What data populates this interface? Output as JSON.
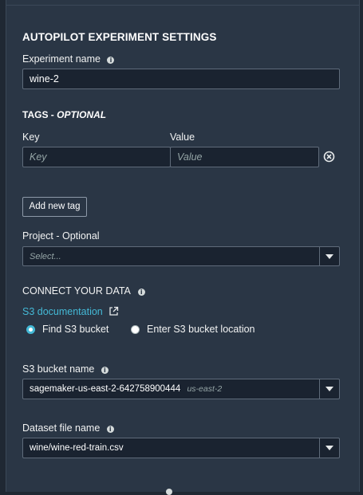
{
  "settings": {
    "title": "AUTOPILOT EXPERIMENT SETTINGS",
    "experiment_name_label": "Experiment name",
    "experiment_name_value": "wine-2"
  },
  "tags": {
    "title_prefix": "TAGS - ",
    "title_optional": "OPTIONAL",
    "key_label": "Key",
    "value_label": "Value",
    "key_placeholder": "Key",
    "value_placeholder": "Value",
    "add_button": "Add new tag"
  },
  "project": {
    "label": "Project - Optional",
    "placeholder": "Select..."
  },
  "connect": {
    "title": "CONNECT YOUR DATA",
    "doc_link": "S3 documentation",
    "option_find": "Find S3 bucket",
    "option_enter": "Enter S3 bucket location",
    "selected_option": "Find S3 bucket"
  },
  "bucket": {
    "label": "S3 bucket name",
    "value": "sagemaker-us-east-2-642758900444",
    "region": "us-east-2"
  },
  "dataset": {
    "label": "Dataset file name",
    "value": "wine/wine-red-train.csv"
  },
  "icons": [
    "info-icon",
    "remove-tag-icon",
    "external-link-icon",
    "dropdown-arrow-icon"
  ],
  "colors": {
    "background": "#1f2833",
    "panel": "#2a3645",
    "link": "#44b9d6",
    "input_bg": "#1a2330"
  }
}
